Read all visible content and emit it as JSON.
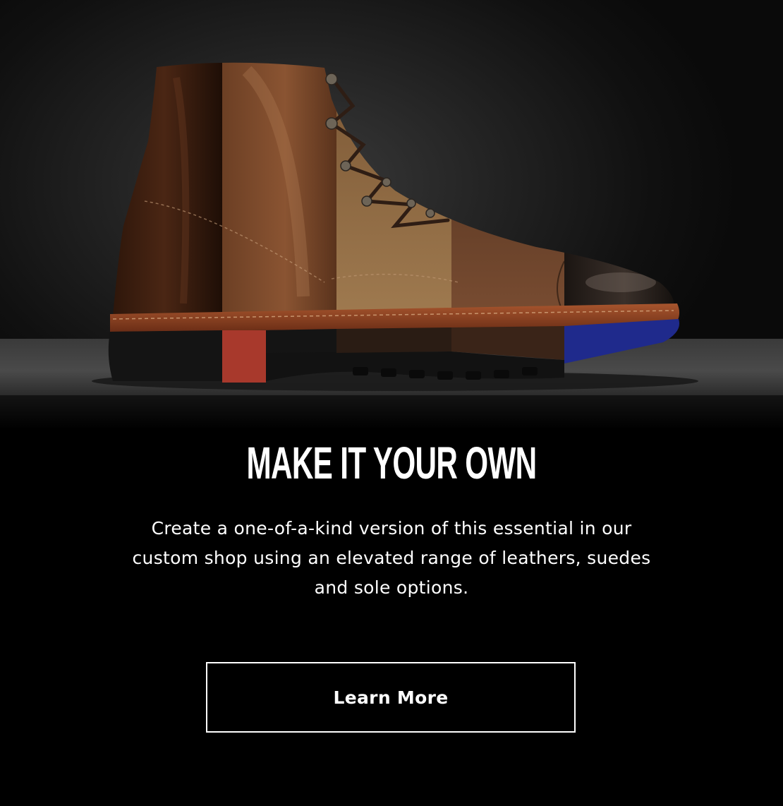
{
  "promo": {
    "headline": "MAKE IT YOUR OWN",
    "body": "Create a one-of-a-kind version of this essential in our custom shop using an elevated range of leathers, suedes and sole options.",
    "cta_label": "Learn More"
  },
  "hero_image": {
    "icon": "custom-boot-image"
  },
  "colors": {
    "background": "#000000",
    "text": "#ffffff",
    "button_border": "#ffffff",
    "boot_leather_dark": "#3b2015",
    "boot_leather_mid": "#6a3d25",
    "boot_suede_tan": "#8c6a45",
    "boot_toe_black": "#141110",
    "sole_red": "#a8392c",
    "sole_blue": "#1f2a8c"
  }
}
